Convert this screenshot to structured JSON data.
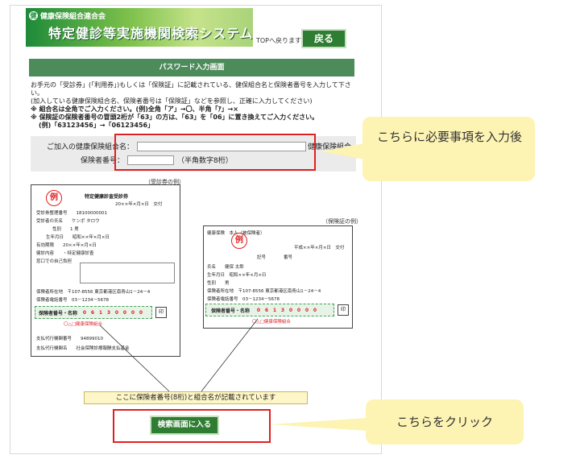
{
  "header": {
    "association": "健康保険組合連合会",
    "title": "特定健診等実施機関検索システム",
    "top_return": "TOPへ戻ります",
    "back_button": "戻る"
  },
  "section_title": "パスワード入力画面",
  "intro": {
    "line1": "お手元の「受診券」(「利用券」)もしくは「保険証」に記載されている、健保組合名と保険者番号を入力して下さい。",
    "line2": "(加入している健康保険組合名、保険者番号は「保険証」などを参照し、正確に入力してください)",
    "line3": "※ 組合名は全角でご入力ください。(例)全角「ア」→〇、半角「ｱ」→×",
    "line4": "※ 保険証の保険者番号の冒頭2桁が「63」の方は、「63」を「06」に置き換えてご入力ください。",
    "line5": "(例)「63123456」→「06123456」"
  },
  "form": {
    "insurer_name_label": "ご加入の健康保険組合名：",
    "insurer_name_value": "",
    "insurer_name_suffix": "健康保険組合",
    "insurer_number_label": "保険者番号：",
    "insurer_number_value": "",
    "insurer_number_hint": "（半角数字8桁）"
  },
  "ticket_sample": {
    "caption": "（受診券の例）",
    "example_mark": "例",
    "heading": "特定健康診査受診券",
    "date_issued": "20××年×月×日　交付",
    "lines": [
      "受診券整理番号　　18100000001",
      "受診者の氏名　　ケンポ タロウ",
      "性別　　1 男",
      "生年月日　　昭和××年×月×日",
      "有効期限　　20××年×月×日",
      "健診内容　　・特定健康診査",
      "窓口での自己負担",
      "保険者所在地　〒107-8556 東京都港区南青山1－24－4",
      "保険者電話番号　03－1234－5678",
      "支払代行機関番号　　94899010",
      "支払代行機関名　　社会保険診療報酬支払基金"
    ],
    "number_label": "保険者番号・名称",
    "digits": [
      "0",
      "6",
      "1",
      "3",
      "0",
      "0",
      "0",
      "0"
    ],
    "strip_note": "〇△□健康保険組合",
    "stamp": "印"
  },
  "insurance_sample": {
    "caption": "（保険証の例）",
    "example_mark": "例",
    "lines": [
      "健康保険　本人（被保険者）",
      "平成××年×月×日　交付",
      "記号　　　　番号",
      "氏名　　健保 太郎",
      "生年月日　昭和××年×月×日",
      "性別　　男",
      "保険者所在地　〒107-8556 東京都港区南青山1－24－4",
      "保険者電話番号　03－1234－5678"
    ],
    "number_label": "保険者番号・名称",
    "digits": [
      "0",
      "6",
      "1",
      "3",
      "0",
      "0",
      "0",
      "0"
    ],
    "strip_note": "〇△□健康保険組合",
    "stamp": "印"
  },
  "sample_note": "ここに保険者番号(8桁)と組合名が記載されています",
  "search_button": "検索画面に入る",
  "callouts": {
    "input": "こちらに必要事項を入力後",
    "click": "こちらをクリック"
  },
  "colors": {
    "accent_green": "#2f7d32",
    "highlight_red": "#e02020",
    "callout_yellow": "#fdf3b3"
  }
}
